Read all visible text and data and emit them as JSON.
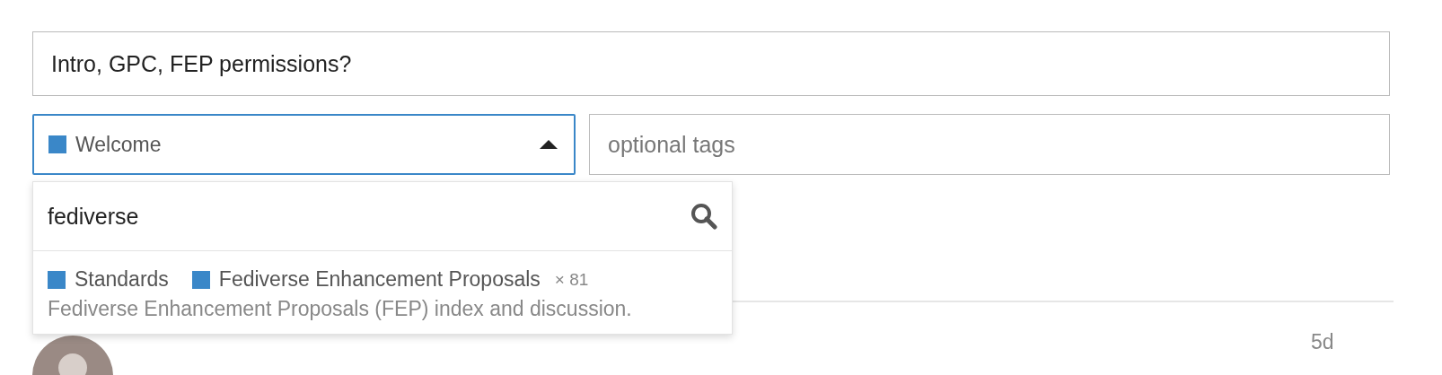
{
  "title_field": {
    "value": "Intro, GPC, FEP permissions?"
  },
  "category_select": {
    "label": "Welcome",
    "color": "#3a87c8",
    "expanded": true
  },
  "tags_field": {
    "placeholder": "optional tags"
  },
  "category_dropdown": {
    "search": {
      "value": "fediverse"
    },
    "results": [
      {
        "parent": {
          "label": "Standards",
          "color": "#3a87c8"
        },
        "label": "Fediverse Enhancement Proposals",
        "color": "#3a87c8",
        "count": "× 81",
        "description": "Fediverse Enhancement Proposals (FEP) index and discussion.",
        "selected": false
      }
    ]
  },
  "topic_row": {
    "age": "5d"
  }
}
